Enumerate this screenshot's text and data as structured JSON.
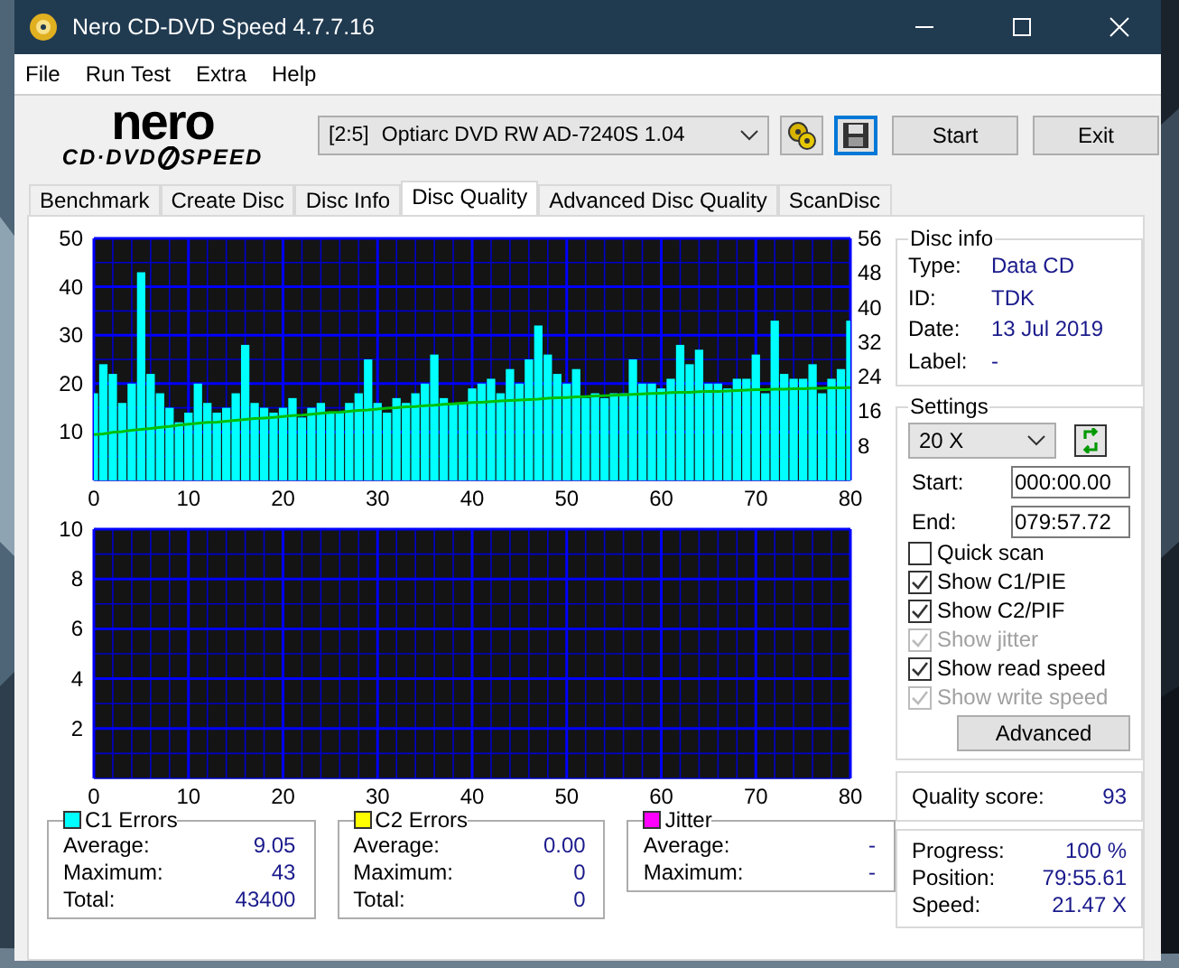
{
  "window": {
    "title": "Nero CD-DVD Speed 4.7.7.16"
  },
  "menu": [
    "File",
    "Run Test",
    "Extra",
    "Help"
  ],
  "logo": {
    "brand": "nero",
    "product_left": "CD·DVD",
    "product_right": "SPEED"
  },
  "toolbar": {
    "drive_id": "[2:5]",
    "drive_name": "Optiarc DVD RW AD-7240S 1.04",
    "start": "Start",
    "exit": "Exit"
  },
  "tabs": [
    {
      "label": "Benchmark",
      "selected": false
    },
    {
      "label": "Create Disc",
      "selected": false
    },
    {
      "label": "Disc Info",
      "selected": false
    },
    {
      "label": "Disc Quality",
      "selected": true
    },
    {
      "label": "Advanced Disc Quality",
      "selected": false
    },
    {
      "label": "ScanDisc",
      "selected": false
    }
  ],
  "c1_chart": {
    "chart_data": {
      "type": "bar",
      "grid": true,
      "xlim": [
        0,
        80
      ],
      "ylim": [
        0,
        50
      ],
      "xticks": [
        0,
        10,
        20,
        30,
        40,
        50,
        60,
        70,
        80
      ],
      "yticks": [
        10,
        20,
        30,
        40,
        50
      ],
      "y2lim": [
        0,
        56
      ],
      "y2ticks": [
        8,
        16,
        24,
        32,
        40,
        48,
        56
      ],
      "x": [
        0,
        1,
        2,
        3,
        4,
        5,
        6,
        7,
        8,
        9,
        10,
        11,
        12,
        13,
        14,
        15,
        16,
        17,
        18,
        19,
        20,
        21,
        22,
        23,
        24,
        25,
        26,
        27,
        28,
        29,
        30,
        31,
        32,
        33,
        34,
        35,
        36,
        37,
        38,
        39,
        40,
        41,
        42,
        43,
        44,
        45,
        46,
        47,
        48,
        49,
        50,
        51,
        52,
        53,
        54,
        55,
        56,
        57,
        58,
        59,
        60,
        61,
        62,
        63,
        64,
        65,
        66,
        67,
        68,
        69,
        70,
        71,
        72,
        73,
        74,
        75,
        76,
        77,
        78,
        79,
        80
      ],
      "series": [
        {
          "color": "#00ffff",
          "values": [
            18,
            24,
            22,
            16,
            20,
            43,
            22,
            18,
            15,
            12,
            14,
            20,
            16,
            14,
            15,
            18,
            28,
            16,
            15,
            14,
            15,
            17,
            13,
            15,
            16,
            14,
            14,
            16,
            18,
            25,
            16,
            14,
            17,
            16,
            18,
            20,
            26,
            17,
            16,
            16,
            19,
            20,
            21,
            18,
            23,
            20,
            25,
            32,
            26,
            22,
            20,
            23,
            17,
            18,
            17,
            18,
            18,
            25,
            20,
            20,
            19,
            21,
            28,
            24,
            27,
            20,
            20,
            19,
            21,
            21,
            26,
            18,
            33,
            22,
            21,
            21,
            24,
            18,
            21,
            23,
            33
          ]
        },
        {
          "type": "line",
          "axis": "y2",
          "color": "#00c000",
          "values": [
            10.6,
            10.8,
            11.1,
            11.3,
            11.6,
            11.8,
            12.0,
            12.3,
            12.5,
            12.8,
            13.0,
            13.2,
            13.4,
            13.5,
            13.7,
            13.9,
            14.1,
            14.3,
            14.4,
            14.6,
            14.8,
            15.0,
            15.1,
            15.3,
            15.5,
            15.7,
            15.8,
            16.0,
            16.2,
            16.3,
            16.5,
            16.7,
            16.8,
            17.0,
            17.1,
            17.3,
            17.4,
            17.6,
            17.7,
            17.9,
            18.0,
            18.1,
            18.2,
            18.4,
            18.5,
            18.6,
            18.7,
            18.8,
            19.0,
            19.1,
            19.2,
            19.3,
            19.4,
            19.5,
            19.6,
            19.7,
            19.8,
            19.9,
            20.0,
            20.1,
            20.2,
            20.3,
            20.4,
            20.4,
            20.5,
            20.6,
            20.6,
            20.7,
            20.8,
            20.9,
            21.0,
            21.0,
            21.1,
            21.1,
            21.2,
            21.2,
            21.3,
            21.3,
            21.4,
            21.4,
            21.5
          ]
        }
      ]
    }
  },
  "c2_chart": {
    "chart_data": {
      "type": "bar",
      "grid": true,
      "xlim": [
        0,
        80
      ],
      "ylim": [
        0,
        10
      ],
      "xticks": [
        0,
        10,
        20,
        30,
        40,
        50,
        60,
        70,
        80
      ],
      "yticks": [
        2,
        4,
        6,
        8,
        10
      ]
    }
  },
  "disc_info": {
    "title": "Disc info",
    "rows": [
      {
        "label": "Type:",
        "value": "Data CD"
      },
      {
        "label": "ID:",
        "value": "TDK"
      },
      {
        "label": "Date:",
        "value": "13 Jul 2019"
      },
      {
        "label": "Label:",
        "value": "-"
      }
    ]
  },
  "settings": {
    "title": "Settings",
    "speed": "20 X",
    "start_label": "Start:",
    "start": "000:00.00",
    "end_label": "End:",
    "end": "079:57.72",
    "options": [
      {
        "label": "Quick scan",
        "checked": false,
        "disabled": false
      },
      {
        "label": "Show C1/PIE",
        "checked": true,
        "disabled": false
      },
      {
        "label": "Show C2/PIF",
        "checked": true,
        "disabled": false
      },
      {
        "label": "Show jitter",
        "checked": true,
        "disabled": true
      },
      {
        "label": "Show read speed",
        "checked": true,
        "disabled": false
      },
      {
        "label": "Show write speed",
        "checked": true,
        "disabled": true
      }
    ],
    "advanced": "Advanced"
  },
  "quality": {
    "label": "Quality score:",
    "value": "93"
  },
  "error_panels": [
    {
      "title": "C1 Errors",
      "color": "#00ffff",
      "rows": [
        {
          "label": "Average:",
          "value": "9.05"
        },
        {
          "label": "Maximum:",
          "value": "43"
        },
        {
          "label": "Total:",
          "value": "43400"
        }
      ]
    },
    {
      "title": "C2 Errors",
      "color": "#ffff00",
      "rows": [
        {
          "label": "Average:",
          "value": "0.00"
        },
        {
          "label": "Maximum:",
          "value": "0"
        },
        {
          "label": "Total:",
          "value": "0"
        }
      ]
    },
    {
      "title": "Jitter",
      "color": "#ff00ff",
      "rows": [
        {
          "label": "Average:",
          "value": "-"
        },
        {
          "label": "Maximum:",
          "value": "-"
        }
      ]
    }
  ],
  "progress": [
    {
      "label": "Progress:",
      "value": "100 %"
    },
    {
      "label": "Position:",
      "value": "79:55.61"
    },
    {
      "label": "Speed:",
      "value": "21.47 X"
    }
  ]
}
